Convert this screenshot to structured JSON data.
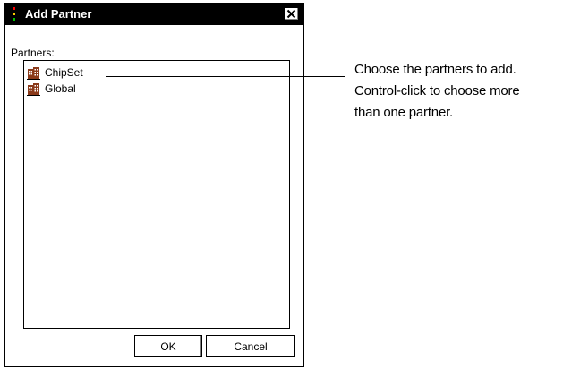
{
  "dialog": {
    "title": "Add Partner",
    "close_glyph": "✕",
    "partners_label": "Partners:",
    "items": [
      {
        "label": "ChipSet",
        "icon": "building-icon"
      },
      {
        "label": "Global",
        "icon": "building-icon"
      }
    ],
    "ok_label": "OK",
    "cancel_label": "Cancel"
  },
  "callout": {
    "lines": [
      "Choose the partners to add.",
      "Control-click to choose more",
      "than one partner."
    ]
  },
  "colors": {
    "titlebar": "#000000",
    "title_icon_red": "#ff0000",
    "title_icon_yellow": "#ffcc00",
    "title_icon_green": "#00c000",
    "icon_brown": "#8b3a1a"
  }
}
